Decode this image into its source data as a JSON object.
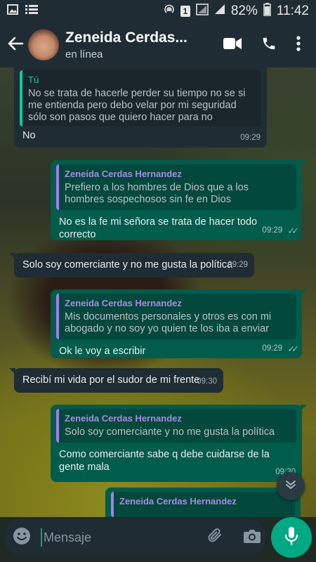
{
  "status_bar": {
    "battery_percent": "82%",
    "time": "11:42",
    "sim_number": "1"
  },
  "header": {
    "contact_name": "Zeneida Cerdas...",
    "status": "en línea"
  },
  "messages": [
    {
      "direction": "in",
      "quote_author": "Tú",
      "quote_text": "No se trata de hacerle perder su tiempo no se si me entienda pero debo velar por mi seguridad sólo son pasos que quiero hacer para no lamentarlo d...",
      "text": "No",
      "time": "09:29"
    },
    {
      "direction": "out",
      "quote_author": "Zeneida Cerdas Hernandez",
      "quote_text": "Prefiero a los hombres de Dios que a los hombres sospechosos sin fe en Dios",
      "text": "No es la fe mi señora se trata de hacer todo correcto",
      "time": "09:29"
    },
    {
      "direction": "in",
      "text": "Solo soy comerciante y no me gusta la política",
      "time": "09:29"
    },
    {
      "direction": "out",
      "quote_author": "Zeneida Cerdas Hernandez",
      "quote_text": "Mis documentos personales y otros es con mi abogado y no soy yo quien te los iba a enviar",
      "text": "Ok le voy a escribir",
      "time": "09:29"
    },
    {
      "direction": "in",
      "text": "Recibí mi vida por el sudor de mi frente",
      "time": "09:30"
    },
    {
      "direction": "out",
      "quote_author": "Zeneida Cerdas Hernandez",
      "quote_text": "Solo soy comerciante y no me gusta la política",
      "text": "Como comerciante sabe q debe cuidarse de la gente mala",
      "time": "09:30"
    },
    {
      "direction": "out",
      "quote_author": "Zeneida Cerdas Hernandez"
    }
  ],
  "composer": {
    "placeholder": "Mensaje"
  },
  "colors": {
    "outgoing_bubble": "#005c4b",
    "incoming_bubble": "#202c33",
    "accent": "#00a884",
    "quote_her": "#a78be0",
    "quote_me": "#06cf9c"
  },
  "icons": {
    "status_left": [
      "image-icon",
      "list-icon"
    ],
    "status_right": [
      "hotspot-icon",
      "sim-icon",
      "no-signal-icon",
      "signal-icon"
    ],
    "header": [
      "back-arrow-icon",
      "video-call-icon",
      "voice-call-icon",
      "more-options-icon"
    ],
    "composer": [
      "emoji-icon",
      "attach-icon",
      "camera-icon",
      "mic-icon"
    ],
    "scroll": "chevron-double-down-icon"
  }
}
